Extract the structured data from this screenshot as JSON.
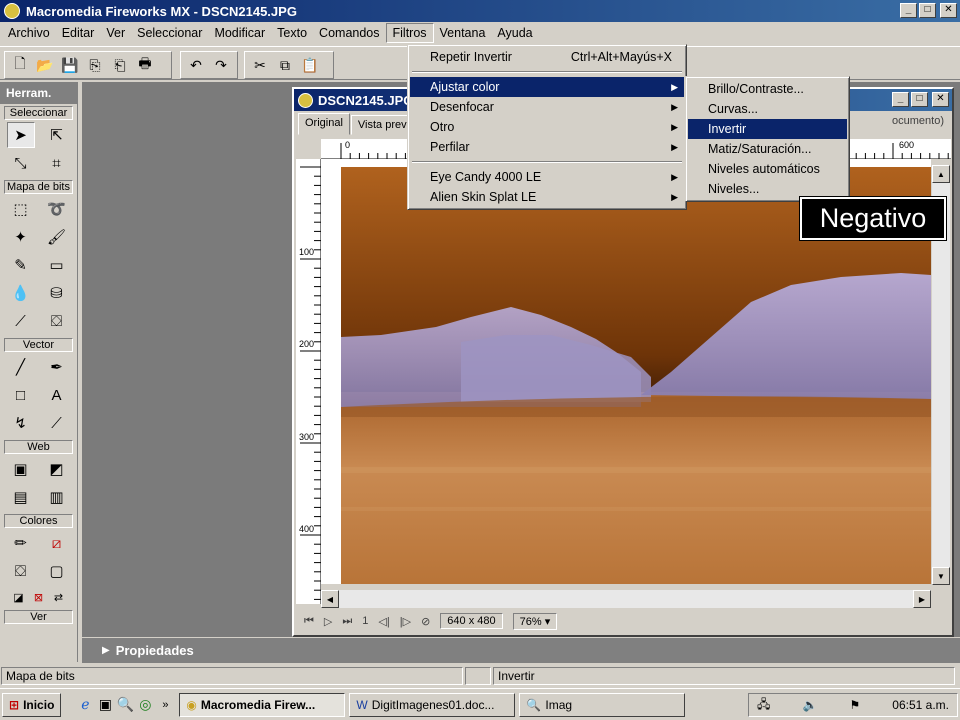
{
  "title_bar": {
    "title": "Macromedia Fireworks MX - DSCN2145.JPG",
    "minimize": "_",
    "maximize": "□",
    "close": "✕"
  },
  "menu": [
    "Archivo",
    "Editar",
    "Ver",
    "Seleccionar",
    "Modificar",
    "Texto",
    "Comandos",
    "Filtros",
    "Ventana",
    "Ayuda"
  ],
  "menu_open_index": 7,
  "toolbar_icons": [
    "new-icon",
    "open-icon",
    "save-icon",
    "import-icon",
    "export-icon",
    "print-icon",
    "undo-icon",
    "redo-icon",
    "cut-icon",
    "copy-icon",
    "paste-icon"
  ],
  "tools_panel": {
    "header": "Herram.",
    "sections": {
      "select": "Seleccionar",
      "bitmap": "Mapa de bits",
      "vector": "Vector",
      "web": "Web",
      "colors": "Colores",
      "view": "Ver"
    }
  },
  "document": {
    "title": "DSCN2145.JPG",
    "tabs": [
      "Original",
      "Vista prev"
    ],
    "tab_right_text": "ocumento)",
    "ruler_h": [
      "0",
      "600"
    ],
    "ruler_v": [
      "100",
      "200",
      "300",
      "400"
    ],
    "status": {
      "page": "1",
      "size": "640 x 480",
      "zoom": "76%"
    }
  },
  "filters_menu": {
    "items": [
      {
        "label": "Repetir Invertir",
        "shortcut": "Ctrl+Alt+Mayús+X"
      },
      {
        "label": "Ajustar color",
        "submenu": true,
        "highlighted": true
      },
      {
        "label": "Desenfocar",
        "submenu": true
      },
      {
        "label": "Otro",
        "submenu": true
      },
      {
        "label": "Perfilar",
        "submenu": true
      },
      {
        "label": "Eye Candy 4000 LE",
        "submenu": true
      },
      {
        "label": "Alien Skin Splat LE",
        "submenu": true
      }
    ]
  },
  "adjust_color_submenu": {
    "items": [
      {
        "label": "Brillo/Contraste..."
      },
      {
        "label": "Curvas..."
      },
      {
        "label": "Invertir",
        "highlighted": true
      },
      {
        "label": "Matiz/Saturación..."
      },
      {
        "label": "Niveles automáticos"
      },
      {
        "label": "Niveles..."
      }
    ]
  },
  "callout": "Negativo",
  "properties_panel": "Propiedades",
  "status_bar": {
    "left": "Mapa de bits",
    "right": "Invertir"
  },
  "taskbar": {
    "start": "Inicio",
    "tasks": [
      "Macromedia Firew...",
      "DigitImagenes01.doc...",
      "Imag"
    ],
    "clock": "06:51 a.m."
  },
  "colors": {
    "title_bar": "#0a246a",
    "highlight": "#0a246a",
    "sky": "#7a3c08",
    "water": "#c8864a"
  }
}
